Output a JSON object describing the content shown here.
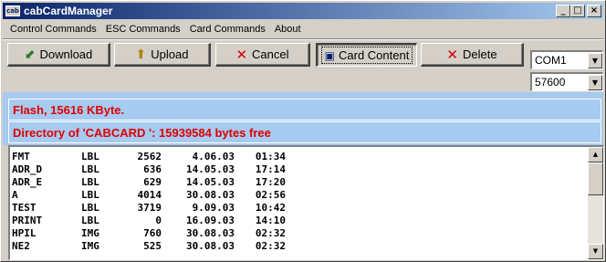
{
  "window": {
    "title": "cabCardManager",
    "icon_label": "cab",
    "minimize": "_",
    "maximize": "□",
    "close": "×"
  },
  "menu": [
    "Control Commands",
    "ESC Commands",
    "Card Commands",
    "About"
  ],
  "toolbar": {
    "download_label": "Download",
    "upload_label": "Upload",
    "cancel_label": "Cancel",
    "card_content_label": "Card Content",
    "delete_label": "Delete"
  },
  "port": {
    "selected": "COM1"
  },
  "baud": {
    "selected": "57600"
  },
  "info": {
    "flash": "Flash, 15616 KByte.",
    "directory": "Directory of 'CABCARD    ':  15939584 bytes free"
  },
  "files": [
    {
      "name": "FMT",
      "type": "LBL",
      "size": "2562",
      "date": "4.06.03",
      "time": "01:34"
    },
    {
      "name": "ADR_D",
      "type": "LBL",
      "size": "636",
      "date": "14.05.03",
      "time": "17:14"
    },
    {
      "name": "ADR_E",
      "type": "LBL",
      "size": "629",
      "date": "14.05.03",
      "time": "17:20"
    },
    {
      "name": "A",
      "type": "LBL",
      "size": "4014",
      "date": "30.08.03",
      "time": "02:56"
    },
    {
      "name": "TEST",
      "type": "LBL",
      "size": "3719",
      "date": "9.09.03",
      "time": "10:42"
    },
    {
      "name": "PRINT",
      "type": "LBL",
      "size": "0",
      "date": "16.09.03",
      "time": "14:10"
    },
    {
      "name": "HPIL",
      "type": "IMG",
      "size": "760",
      "date": "30.08.03",
      "time": "02:32"
    },
    {
      "name": "NE2",
      "type": "IMG",
      "size": "525",
      "date": "30.08.03",
      "time": "02:32"
    }
  ],
  "icons": {
    "download": "download-icon",
    "upload": "upload-icon",
    "cancel": "x-icon",
    "card_content": "card-view-icon",
    "delete": "x-icon"
  },
  "colors": {
    "title_start": "#0a246a",
    "title_end": "#a6caf0",
    "info_strip": "#a6caf0",
    "info_text": "#e00000"
  }
}
